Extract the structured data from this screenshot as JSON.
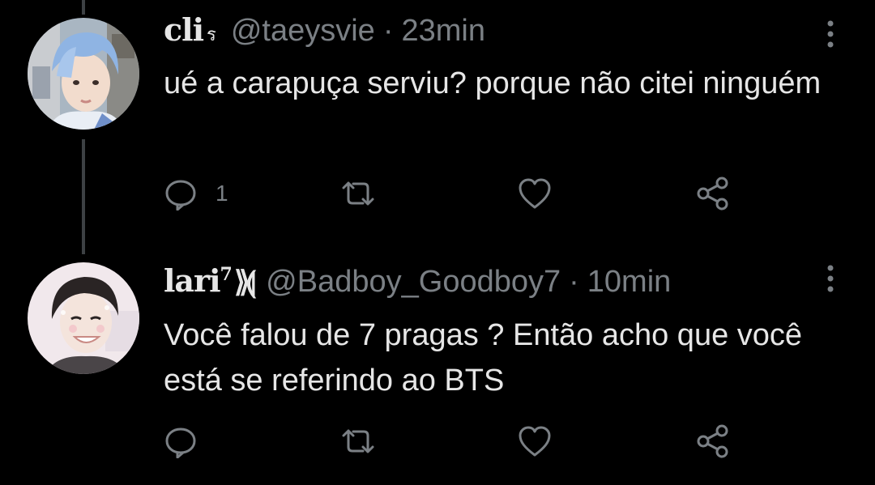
{
  "tweets": [
    {
      "display_name": "cli",
      "name_suffix": "ร",
      "handle": "@taeysvie",
      "separator": "·",
      "time": "23min",
      "text": "ué a carapuça serviu? porque não citei ninguém",
      "reply_count": "1",
      "avatar_colors": {
        "hair": "#8fb4e3",
        "bg": "#b9c4cf"
      }
    },
    {
      "display_name": "lari",
      "name_superscript": "7",
      "name_glyph": "⟫⟬",
      "handle": "@Badboy_Goodboy7",
      "separator": "·",
      "time": "10min",
      "text": "Você falou de 7 pragas ? Então acho que você está se referindo ao BTS",
      "reply_count": "",
      "avatar_colors": {
        "hair": "#2a2424",
        "bg": "#f1e8ec"
      }
    }
  ],
  "icons": {
    "reply": "reply-icon",
    "retweet": "retweet-icon",
    "like": "like-icon",
    "share": "share-icon",
    "more": "more-options-icon"
  },
  "colors": {
    "background": "#000000",
    "text": "#e6e6e6",
    "secondary": "#7b8085",
    "thread_line": "#3d4144"
  }
}
